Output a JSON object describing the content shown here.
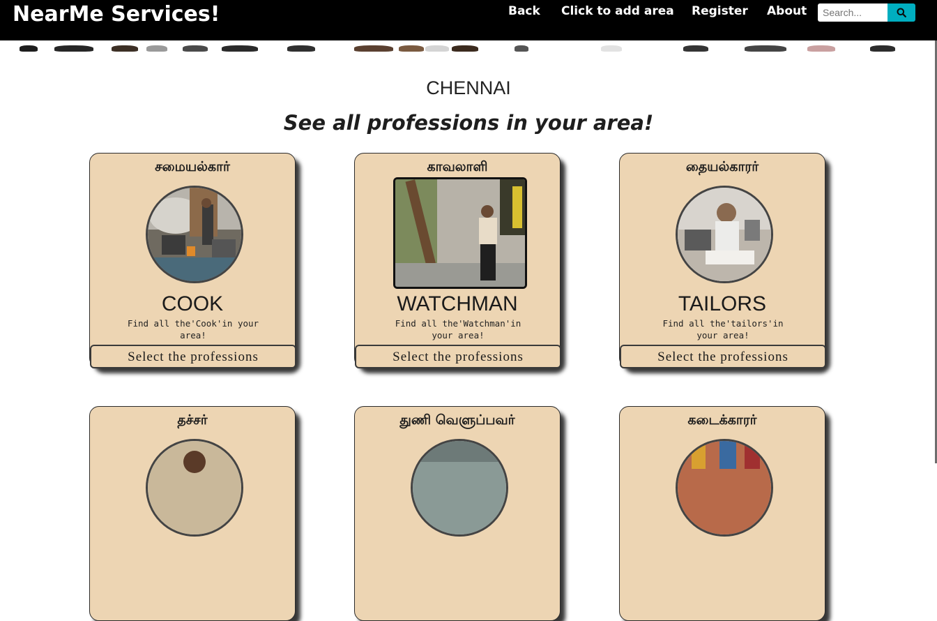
{
  "navbar": {
    "brand": "NearMe Services!",
    "links": {
      "back": "Back",
      "add_area": "Click to add area",
      "register": "Register",
      "about": "About"
    },
    "search": {
      "placeholder": "Search..."
    }
  },
  "page": {
    "city": "CHENNAI",
    "tagline": "See all professions in your area!"
  },
  "cards": [
    {
      "tamil": "சமையல்கார்",
      "title": "COOK",
      "desc": "Find all the'Cook'in your area!",
      "select_label": "Select the professions",
      "image_shape": "circle"
    },
    {
      "tamil": "காவலாளி",
      "title": "WATCHMAN",
      "desc": "Find all the'Watchman'in your area!",
      "select_label": "Select the professions",
      "image_shape": "square"
    },
    {
      "tamil": "தையல்காரர்",
      "title": "TAILORS",
      "desc": "Find all the'tailors'in your area!",
      "select_label": "Select the professions",
      "image_shape": "circle"
    },
    {
      "tamil": "தச்சர்",
      "image_shape": "circle"
    },
    {
      "tamil": "துணி வெளுப்பவர்",
      "image_shape": "circle"
    },
    {
      "tamil": "கடைக்காரர்",
      "image_shape": "circle"
    }
  ],
  "colors": {
    "navbar": "#000000",
    "card_bg": "#edd5b3",
    "search_button": "#00aec0"
  },
  "icons": {
    "search": "search-icon"
  }
}
